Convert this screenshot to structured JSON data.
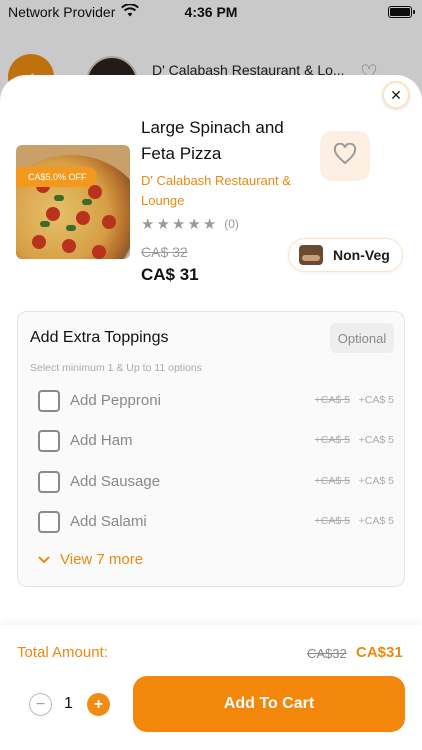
{
  "status_bar": {
    "carrier": "Network Provider",
    "time": "4:36 PM"
  },
  "background": {
    "restaurant_title": "D' Calabash Restaurant & Lo..."
  },
  "product": {
    "name": "Large Spinach and Feta Pizza",
    "restaurant": "D' Calabash Restaurant & Lounge",
    "offer_badge": "CA$5.0% OFF",
    "rating_stars": 5,
    "rating_count": "(0)",
    "old_price": "CA$ 32",
    "price": "CA$ 31",
    "diet_label": "Non-Veg"
  },
  "toppings": {
    "title": "Add Extra Toppings",
    "badge": "Optional",
    "hint": "Select minimum 1 & Up to 11 options",
    "items": [
      {
        "name": "Add Pepproni",
        "old_price": "+CA$ 5",
        "price": "+CA$ 5"
      },
      {
        "name": "Add Ham",
        "old_price": "+CA$ 5",
        "price": "+CA$ 5"
      },
      {
        "name": "Add Sausage",
        "old_price": "+CA$ 5",
        "price": "+CA$ 5"
      },
      {
        "name": "Add Salami",
        "old_price": "+CA$ 5",
        "price": "+CA$ 5"
      }
    ],
    "view_more": "View 7 more"
  },
  "footer": {
    "total_label": "Total Amount:",
    "total_old": "CA$32",
    "total_new": "CA$31",
    "quantity": "1",
    "add_to_cart": "Add To Cart"
  },
  "colors": {
    "accent": "#F3870B",
    "accent_light": "#FDF0E3"
  },
  "icons": [
    "wifi-icon",
    "battery-icon",
    "back-arrow-icon",
    "heart-icon",
    "close-icon",
    "star-icon",
    "food-icon",
    "checkbox-icon",
    "chevron-down-icon",
    "minus-icon",
    "plus-icon"
  ]
}
